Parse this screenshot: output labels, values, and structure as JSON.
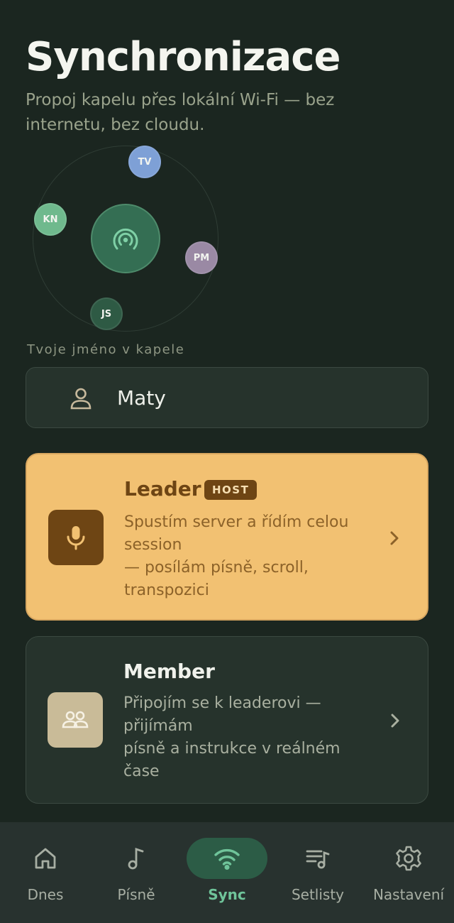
{
  "header": {
    "title": "Synchronizace",
    "subtitle": "Propoj kapelu přes lokální Wi-Fi — bez internetu, bez cloudu."
  },
  "radar": {
    "center_icon": "broadcast-icon",
    "peers": [
      {
        "initials": "TV",
        "color": "#7ea0d6"
      },
      {
        "initials": "KN",
        "color": "#6fb98d"
      },
      {
        "initials": "PM",
        "color": "#9a89a4"
      },
      {
        "initials": "JS",
        "color": "#2e5a44"
      }
    ]
  },
  "name_field": {
    "label": "Tvoje jméno v kapele",
    "value": "Maty",
    "icon": "person-icon"
  },
  "roles": {
    "leader": {
      "title": "Leader",
      "badge": "HOST",
      "desc_line1": "Spustím server a řídím celou session",
      "desc_line2": "— posílám písně, scroll, transpozici",
      "icon": "microphone-icon"
    },
    "member": {
      "title": "Member",
      "desc_line1": "Připojím se k leaderovi — přijímám",
      "desc_line2": "písně a instrukce v reálném čase",
      "icon": "group-icon"
    }
  },
  "nav": {
    "items": [
      {
        "label": "Dnes",
        "icon": "home-icon"
      },
      {
        "label": "Písně",
        "icon": "music-note-icon"
      },
      {
        "label": "Sync",
        "icon": "wifi-icon",
        "active": true
      },
      {
        "label": "Setlisty",
        "icon": "playlist-icon"
      },
      {
        "label": "Nastavení",
        "icon": "gear-icon"
      }
    ]
  },
  "colors": {
    "background": "#1b2620",
    "accent": "#6fc49a",
    "leader_card": "#f2c172",
    "leader_dark": "#6e4514",
    "surface": "#26332c"
  }
}
